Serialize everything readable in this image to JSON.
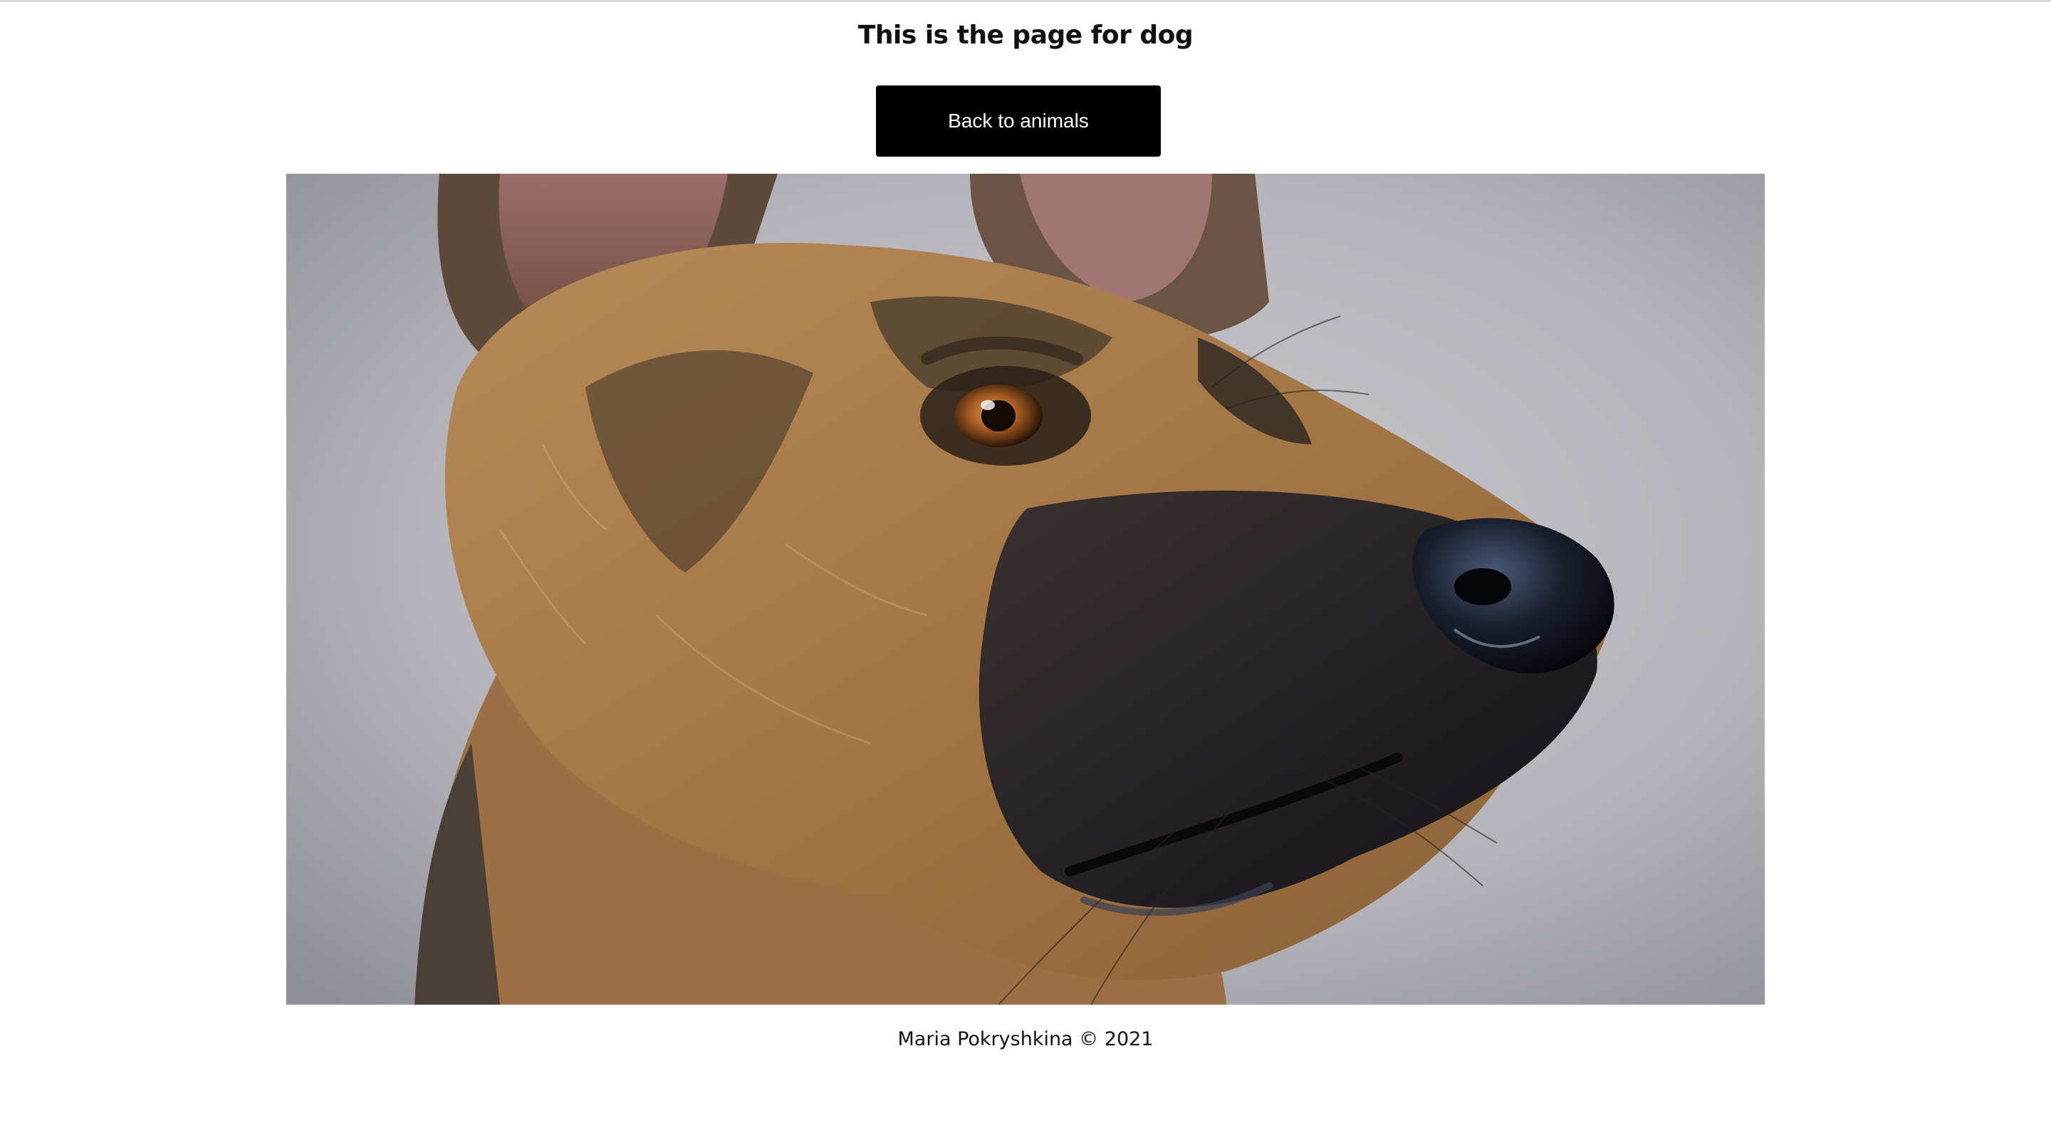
{
  "header": {
    "title": "This is the page for dog"
  },
  "actions": {
    "back_label": "Back to animals"
  },
  "main": {
    "image_icon": "dog-photo",
    "image_alt": "dog"
  },
  "footer": {
    "text": "Maria Pokryshkina © 2021"
  },
  "colors": {
    "button_bg": "#000000",
    "button_text": "#ffffff",
    "page_bg": "#ffffff",
    "text": "#111111"
  }
}
